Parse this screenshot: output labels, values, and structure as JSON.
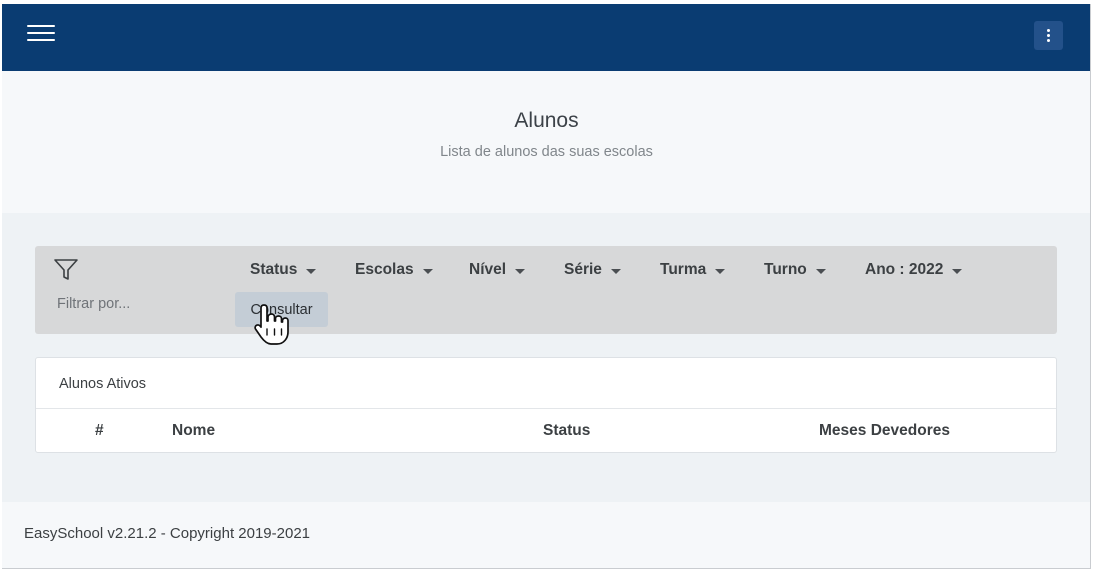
{
  "header": {
    "menu_icon": "hamburger-menu-icon",
    "more_icon": "kebab-more-icon",
    "bg_color": "#0a3c72"
  },
  "page": {
    "title": "Alunos",
    "subtitle": "Lista de alunos das suas escolas"
  },
  "filters": {
    "icon": "funnel-filter-icon",
    "search_placeholder": "Filtrar por...",
    "dropdowns": [
      {
        "label": "Status"
      },
      {
        "label": "Escolas"
      },
      {
        "label": "Nível"
      },
      {
        "label": "Série"
      },
      {
        "label": "Turma"
      },
      {
        "label": "Turno"
      },
      {
        "label": "Ano : 2022"
      }
    ],
    "consult_button": "Consultar"
  },
  "table": {
    "title": "Alunos Ativos",
    "columns": [
      "#",
      "Nome",
      "Status",
      "Meses Devedores"
    ],
    "rows": []
  },
  "footer": {
    "text": "EasySchool v2.21.2 - Copyright 2019-2021"
  }
}
